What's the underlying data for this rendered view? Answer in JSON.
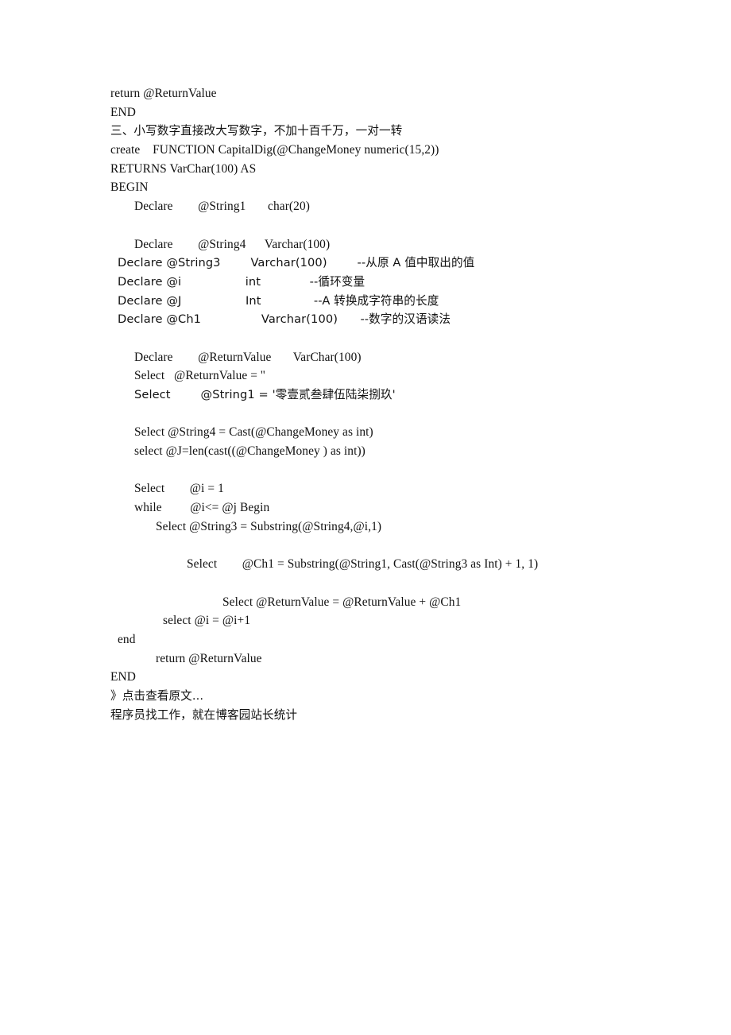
{
  "document": {
    "page_background": "#ffffff",
    "text_color": "#111111",
    "lines": [
      {
        "id": "l01",
        "indent": 0,
        "script": "latin",
        "text": "return @ReturnValue"
      },
      {
        "id": "l02",
        "indent": 0,
        "script": "latin",
        "text": "END"
      },
      {
        "id": "l03",
        "indent": 0,
        "script": "cjk",
        "text": "三、小写数字直接改大写数字，不加十百千万，一对一转"
      },
      {
        "id": "l04",
        "indent": 0,
        "script": "latin",
        "text": "create    FUNCTION CapitalDig(@ChangeMoney numeric(15,2))"
      },
      {
        "id": "l05",
        "indent": 0,
        "script": "latin",
        "text": "RETURNS VarChar(100) AS"
      },
      {
        "id": "l06",
        "indent": 0,
        "script": "latin",
        "text": "BEGIN"
      },
      {
        "id": "l07",
        "indent": 2,
        "script": "latin",
        "text": "Declare        @String1       char(20)"
      },
      {
        "id": "l08",
        "indent": 0,
        "script": "latin",
        "text": ""
      },
      {
        "id": "l09",
        "indent": 2,
        "script": "latin",
        "text": "Declare        @String4      Varchar(100)"
      },
      {
        "id": "l10",
        "indent": 1,
        "script": "cjk",
        "text": "Declare @String3        Varchar(100)        --从原 A 值中取出的值"
      },
      {
        "id": "l11",
        "indent": 1,
        "script": "cjk",
        "text": "Declare @i                 int             --循环变量"
      },
      {
        "id": "l12",
        "indent": 1,
        "script": "cjk",
        "text": "Declare @J                 Int              --A 转换成字符串的长度"
      },
      {
        "id": "l13",
        "indent": 1,
        "script": "cjk",
        "text": "Declare @Ch1                Varchar(100)      --数字的汉语读法"
      },
      {
        "id": "l14",
        "indent": 0,
        "script": "latin",
        "text": ""
      },
      {
        "id": "l15",
        "indent": 2,
        "script": "latin",
        "text": "Declare        @ReturnValue       VarChar(100)"
      },
      {
        "id": "l16",
        "indent": 2,
        "script": "latin",
        "text": "Select   @ReturnValue = ''"
      },
      {
        "id": "l17",
        "indent": 2,
        "script": "cjk",
        "text": "Select        @String1 = '零壹贰叁肆伍陆柒捌玖'"
      },
      {
        "id": "l18",
        "indent": 0,
        "script": "latin",
        "text": ""
      },
      {
        "id": "l19",
        "indent": 2,
        "script": "latin",
        "text": "Select @String4 = Cast(@ChangeMoney as int)"
      },
      {
        "id": "l20",
        "indent": 2,
        "script": "latin",
        "text": "select @J=len(cast((@ChangeMoney ) as int))"
      },
      {
        "id": "l21",
        "indent": 0,
        "script": "latin",
        "text": ""
      },
      {
        "id": "l22",
        "indent": 2,
        "script": "latin",
        "text": "Select        @i = 1"
      },
      {
        "id": "l23",
        "indent": 2,
        "script": "latin",
        "text": "while         @i<= @j Begin"
      },
      {
        "id": "l24",
        "indent": 3,
        "script": "latin",
        "text": "Select @String3 = Substring(@String4,@i,1)"
      },
      {
        "id": "l25",
        "indent": 0,
        "script": "latin",
        "text": ""
      },
      {
        "id": "l26",
        "indent": 5,
        "script": "latin",
        "text": "Select        @Ch1 = Substring(@String1, Cast(@String3 as Int) + 1, 1)"
      },
      {
        "id": "l27",
        "indent": 0,
        "script": "latin",
        "text": ""
      },
      {
        "id": "l28",
        "indent": 6,
        "script": "latin",
        "text": "Select @ReturnValue = @ReturnValue + @Ch1"
      },
      {
        "id": "l29",
        "indent": 4,
        "script": "latin",
        "text": "select @i = @i+1"
      },
      {
        "id": "l30",
        "indent": 1,
        "script": "latin",
        "text": "end"
      },
      {
        "id": "l31",
        "indent": 3,
        "script": "latin",
        "text": "return @ReturnValue"
      },
      {
        "id": "l32",
        "indent": 0,
        "script": "latin",
        "text": "END"
      },
      {
        "id": "l33",
        "indent": 0,
        "script": "cjk",
        "text": "》点击查看原文..."
      },
      {
        "id": "l34",
        "indent": 0,
        "script": "cjk",
        "text": "程序员找工作，就在博客园站长统计"
      }
    ]
  }
}
